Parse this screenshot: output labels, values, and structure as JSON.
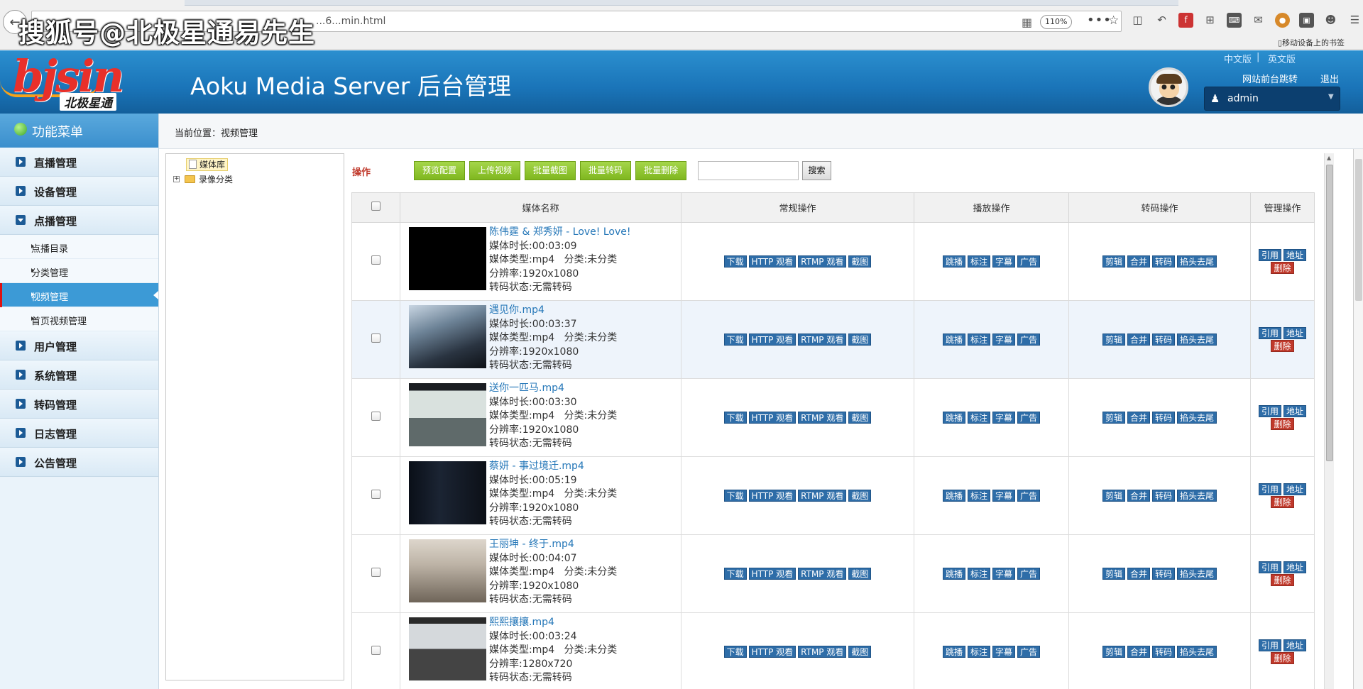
{
  "browser": {
    "url": "...6...min.html",
    "zoom": "110%",
    "more": "•••",
    "mobile_bookmarks": "移动设备上的书签",
    "watermark": "搜狐号@北极星通易先生"
  },
  "header": {
    "logo_text": "bjsin",
    "logo_sub": "北极星通",
    "title": "Aoku Media Server 后台管理",
    "lang_cn": "中文版",
    "lang_sep": "|",
    "lang_en": "英文版",
    "front_link": "网站前台跳转",
    "logout": "退出",
    "username": "admin"
  },
  "sidebar": {
    "title": "功能菜单",
    "groups": [
      {
        "label": "直播管理"
      },
      {
        "label": "设备管理"
      },
      {
        "label": "点播管理"
      },
      {
        "label": "用户管理"
      },
      {
        "label": "系统管理"
      },
      {
        "label": "转码管理"
      },
      {
        "label": "日志管理"
      },
      {
        "label": "公告管理"
      }
    ],
    "sub_items": [
      {
        "label": "点播目录"
      },
      {
        "label": "分类管理"
      },
      {
        "label": "视频管理",
        "active": true
      },
      {
        "label": "首页视频管理"
      }
    ]
  },
  "breadcrumb": "当前位置：视频管理",
  "tree": {
    "root": "媒体库",
    "child": "录像分类"
  },
  "operations": {
    "label": "操作",
    "buttons": [
      "预览配置",
      "上传视频",
      "批量截图",
      "批量转码",
      "批量删除"
    ],
    "search_value": "",
    "search_button": "搜索"
  },
  "table": {
    "headers": [
      "",
      "媒体名称",
      "常规操作",
      "播放操作",
      "转码操作",
      "管理操作"
    ],
    "regular_ops": [
      "下载",
      "HTTP 观看",
      "RTMP 观看",
      "截图"
    ],
    "play_ops": [
      "跳播",
      "标注",
      "字幕",
      "广告"
    ],
    "transcode_ops": [
      "剪辑",
      "合并",
      "转码",
      "掐头去尾"
    ],
    "manage_ops": [
      "引用",
      "地址",
      "删除"
    ],
    "rows": [
      {
        "title": "陈伟霆 & 郑秀妍 - Love! Love!",
        "duration": "媒体时长:00:03:09",
        "type": "媒体类型:mp4",
        "category": "分类:未分类",
        "resolution": "分辨率:1920x1080",
        "status": "转码状态:无需转码"
      },
      {
        "title": "遇见你.mp4",
        "duration": "媒体时长:00:03:37",
        "type": "媒体类型:mp4",
        "category": "分类:未分类",
        "resolution": "分辨率:1920x1080",
        "status": "转码状态:无需转码"
      },
      {
        "title": "送你一匹马.mp4",
        "duration": "媒体时长:00:03:30",
        "type": "媒体类型:mp4",
        "category": "分类:未分类",
        "resolution": "分辨率:1920x1080",
        "status": "转码状态:无需转码"
      },
      {
        "title": "蔡妍 - 事过境迁.mp4",
        "duration": "媒体时长:00:05:19",
        "type": "媒体类型:mp4",
        "category": "分类:未分类",
        "resolution": "分辨率:1920x1080",
        "status": "转码状态:无需转码"
      },
      {
        "title": "王丽坤 - 终于.mp4",
        "duration": "媒体时长:00:04:07",
        "type": "媒体类型:mp4",
        "category": "分类:未分类",
        "resolution": "分辨率:1920x1080",
        "status": "转码状态:无需转码"
      },
      {
        "title": "熙熙攘攘.mp4",
        "duration": "媒体时长:00:03:24",
        "type": "媒体类型:mp4",
        "category": "分类:未分类",
        "resolution": "分辨率:1280x720",
        "status": "转码状态:无需转码"
      }
    ]
  }
}
